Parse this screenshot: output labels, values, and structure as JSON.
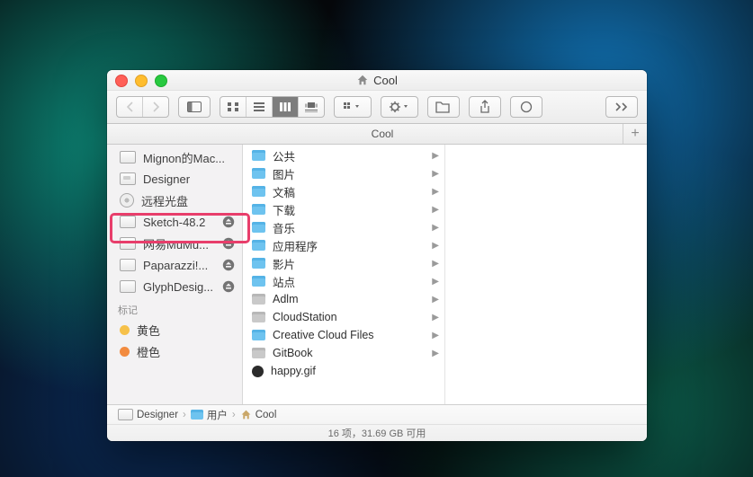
{
  "window": {
    "title": "Cool"
  },
  "pathbar": {
    "label": "Cool"
  },
  "sidebar": {
    "items": [
      {
        "label": "Mignon的Mac...",
        "icon": "disk",
        "eject": false
      },
      {
        "label": "Designer",
        "icon": "disk-ext",
        "eject": false
      },
      {
        "label": "远程光盘",
        "icon": "cd",
        "eject": false
      },
      {
        "label": "Sketch-48.2",
        "icon": "disk",
        "eject": true,
        "highlighted": true
      },
      {
        "label": "网易MuMu...",
        "icon": "disk",
        "eject": true
      },
      {
        "label": "Paparazzi!...",
        "icon": "disk",
        "eject": true
      },
      {
        "label": "GlyphDesig...",
        "icon": "disk",
        "eject": true
      }
    ],
    "tags_header": "标记",
    "tags": [
      {
        "label": "黄色",
        "color": "#f6c14a"
      },
      {
        "label": "橙色",
        "color": "#f28b3f"
      }
    ]
  },
  "files": {
    "items": [
      {
        "label": "公共",
        "icon": "folder",
        "has_children": true
      },
      {
        "label": "图片",
        "icon": "folder",
        "has_children": true
      },
      {
        "label": "文稿",
        "icon": "folder",
        "has_children": true
      },
      {
        "label": "下载",
        "icon": "folder",
        "has_children": true
      },
      {
        "label": "音乐",
        "icon": "folder",
        "has_children": true
      },
      {
        "label": "应用程序",
        "icon": "folder",
        "has_children": true
      },
      {
        "label": "影片",
        "icon": "folder",
        "has_children": true
      },
      {
        "label": "站点",
        "icon": "folder",
        "has_children": true
      },
      {
        "label": "Adlm",
        "icon": "gray",
        "has_children": true
      },
      {
        "label": "CloudStation",
        "icon": "gray",
        "has_children": true
      },
      {
        "label": "Creative Cloud Files",
        "icon": "folder",
        "has_children": true
      },
      {
        "label": "GitBook",
        "icon": "gray",
        "has_children": true
      },
      {
        "label": "happy.gif",
        "icon": "happy",
        "has_children": false
      }
    ]
  },
  "breadcrumb": {
    "items": [
      {
        "label": "Designer",
        "icon": "disk"
      },
      {
        "label": "用户",
        "icon": "folder"
      },
      {
        "label": "Cool",
        "icon": "home"
      }
    ]
  },
  "status": "16 项，31.69 GB 可用"
}
